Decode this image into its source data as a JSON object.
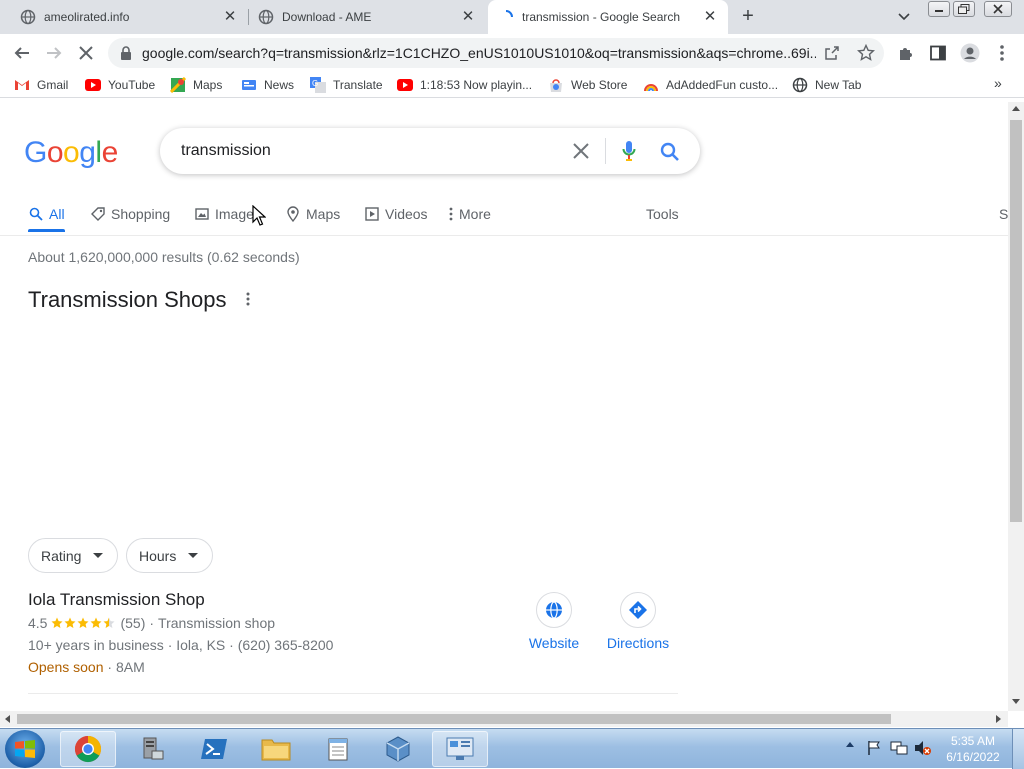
{
  "browser": {
    "tabs": [
      {
        "title": "ameolirated.info",
        "active": false
      },
      {
        "title": "Download - AME",
        "active": false
      },
      {
        "title": "transmission - Google Search",
        "active": true
      }
    ],
    "new_tab_label": "+",
    "url": "google.com/search?q=transmission&rlz=1C1CHZO_enUS1010US1010&oq=transmission&aqs=chrome..69i...",
    "bookmarks": [
      {
        "label": "Gmail",
        "icon": "gmail-icon"
      },
      {
        "label": "YouTube",
        "icon": "youtube-icon"
      },
      {
        "label": "Maps",
        "icon": "maps-icon"
      },
      {
        "label": "News",
        "icon": "news-icon"
      },
      {
        "label": "Translate",
        "icon": "translate-icon"
      },
      {
        "label": "1:18:53 Now playin...",
        "icon": "youtube-icon"
      },
      {
        "label": "Web Store",
        "icon": "webstore-icon"
      },
      {
        "label": "AdAddedFun custo...",
        "icon": "adaddedfun-icon"
      },
      {
        "label": "New Tab",
        "icon": "globe-icon"
      }
    ]
  },
  "google": {
    "logo": [
      "G",
      "o",
      "o",
      "g",
      "l",
      "e"
    ],
    "logo_colors": [
      "#4285f4",
      "#ea4335",
      "#fbbc05",
      "#4285f4",
      "#34a853",
      "#ea4335"
    ],
    "query": "transmission",
    "nav": [
      {
        "label": "All",
        "icon": "search-icon",
        "active": true
      },
      {
        "label": "Shopping",
        "icon": "tag-icon",
        "active": false
      },
      {
        "label": "Images",
        "icon": "image-icon",
        "active": false
      },
      {
        "label": "Maps",
        "icon": "map-pin-icon",
        "active": false
      },
      {
        "label": "Videos",
        "icon": "play-icon",
        "active": false
      },
      {
        "label": "More",
        "icon": "more-vert-icon",
        "active": false
      }
    ],
    "tools_label": "Tools",
    "cut_label": "S",
    "result_stats": "About 1,620,000,000 results (0.62 seconds)",
    "local_pack": {
      "heading": "Transmission Shops",
      "filters": [
        "Rating",
        "Hours"
      ],
      "listing": {
        "name": "Iola Transmission Shop",
        "rating": "4.5",
        "rating_value": 4.5,
        "reviews": "(55)",
        "category": "Transmission shop",
        "details": "10+ years in business · Iola, KS · (620) 365-8200",
        "hours_status": "Opens soon",
        "hours_time": "· 8AM",
        "actions": [
          {
            "label": "Website",
            "icon": "globe-icon"
          },
          {
            "label": "Directions",
            "icon": "directions-icon"
          }
        ]
      }
    }
  },
  "taskbar": {
    "time": "5:35 AM",
    "date": "6/16/2022",
    "apps": [
      "chrome-icon",
      "server-manager-icon",
      "powershell-icon",
      "explorer-icon",
      "notepad-icon",
      "virtualbox-icon",
      "control-panel-icon"
    ]
  },
  "colors": {
    "link_blue": "#1a0dab",
    "accent_blue": "#1a73e8",
    "star_yellow": "#fbbc04",
    "opens_soon": "#b06000"
  }
}
